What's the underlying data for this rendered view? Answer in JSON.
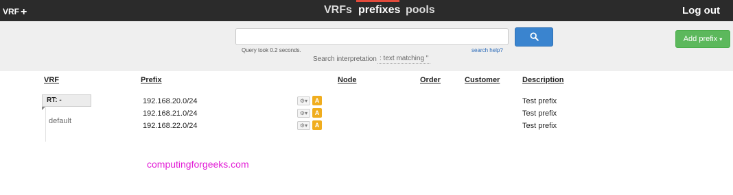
{
  "topbar": {
    "vrf_label": "VRF",
    "vrf_plus": "+",
    "nav": [
      {
        "label": "VRFs",
        "active": false
      },
      {
        "label": "prefixes",
        "active": true
      },
      {
        "label": "pools",
        "active": false
      }
    ],
    "logout_label": "Log out"
  },
  "search": {
    "value": "",
    "placeholder": "",
    "button_icon": "search-icon",
    "query_time": "Query took 0.2 seconds.",
    "help_link": "search help?",
    "interpretation_label": "Search interpretation",
    "interpretation_value": ": text matching \""
  },
  "actions": {
    "add_prefix_label": "Add prefix",
    "add_prefix_caret": "▾"
  },
  "table": {
    "headers": {
      "vrf": "VRF",
      "prefix": "Prefix",
      "node": "Node",
      "order": "Order",
      "customer": "Customer",
      "description": "Description"
    },
    "vrf_group": {
      "label": "RT: -",
      "name": "default"
    },
    "rows": [
      {
        "prefix": "192.168.20.0/24",
        "type": "A",
        "description": "Test prefix"
      },
      {
        "prefix": "192.168.21.0/24",
        "type": "A",
        "description": "Test prefix"
      },
      {
        "prefix": "192.168.22.0/24",
        "type": "A",
        "description": "Test prefix"
      }
    ],
    "gear_glyph": "⚙▾"
  },
  "watermark": "computingforgeeks.com",
  "colors": {
    "topbar_bg": "#2b2b2b",
    "active_indicator": "#e24a3b",
    "search_button": "#3a84cf",
    "add_button": "#5cb85c",
    "type_badge": "#f0ad1e",
    "watermark": "#e21cd6"
  }
}
